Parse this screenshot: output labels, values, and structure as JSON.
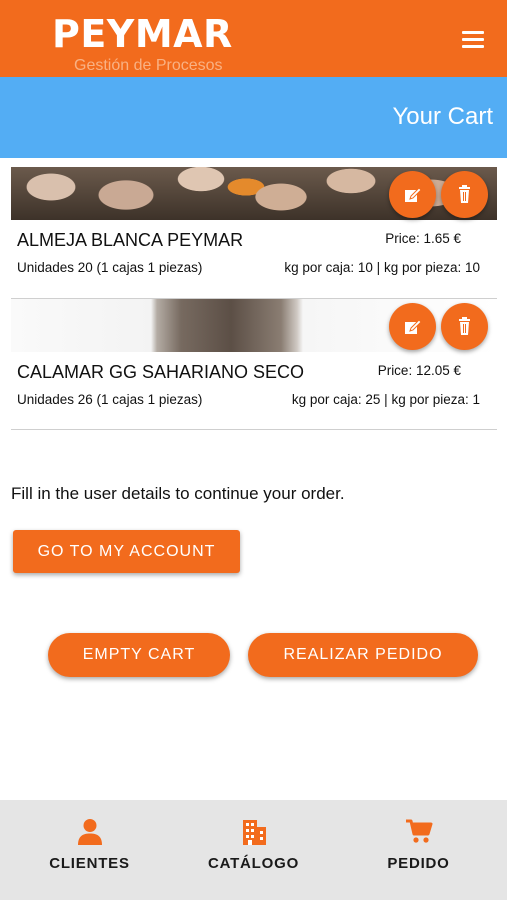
{
  "header": {
    "brand": "PEYMAR",
    "subtitle": "Gestión de Procesos"
  },
  "page_title": "Your Cart",
  "cart": {
    "items": [
      {
        "name": "ALMEJA BLANCA PEYMAR",
        "price": "Price: 1.65 €",
        "units": "Unidades 20 (1 cajas 1 piezas)",
        "kg": "kg por caja: 10 | kg por pieza: 10"
      },
      {
        "name": "CALAMAR GG SAHARIANO SECO",
        "price": "Price: 12.05 €",
        "units": "Unidades 26 (1 cajas 1 piezas)",
        "kg": "kg por caja: 25 | kg por pieza: 1"
      }
    ]
  },
  "notice": "Fill in the user details to continue your order.",
  "buttons": {
    "account": "GO TO MY ACCOUNT",
    "empty": "EMPTY CART",
    "order": "REALIZAR PEDIDO"
  },
  "bottom_nav": [
    {
      "label": "CLIENTES",
      "icon": "person-icon"
    },
    {
      "label": "CATÁLOGO",
      "icon": "building-icon"
    },
    {
      "label": "PEDIDO",
      "icon": "cart-icon"
    }
  ],
  "colors": {
    "accent": "#f26b1d",
    "title_bar": "#53adf4",
    "nav_background": "#e5e5e5"
  }
}
